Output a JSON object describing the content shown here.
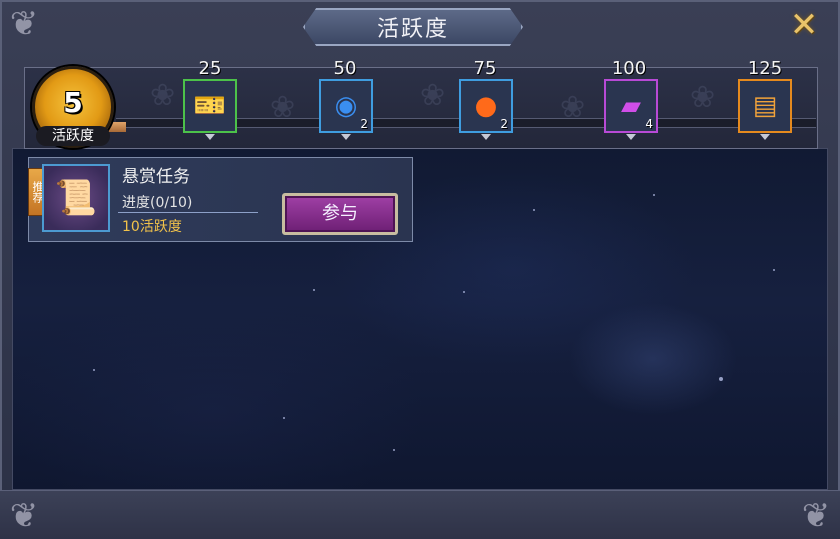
{
  "window": {
    "title": "活跃度",
    "close_icon": "close-x-icon"
  },
  "activity": {
    "current": "5",
    "label": "活跃度",
    "progress_fraction": 0.04
  },
  "milestones": [
    {
      "threshold": "25",
      "icon": "ticket-icon",
      "count": "",
      "border": "#4cc24a"
    },
    {
      "threshold": "50",
      "icon": "blue-orb-scroll-icon",
      "count": "2",
      "border": "#3f9de0"
    },
    {
      "threshold": "75",
      "icon": "fire-orb-icon",
      "count": "2",
      "border": "#3f9de0"
    },
    {
      "threshold": "100",
      "icon": "purple-card-icon",
      "count": "4",
      "border": "#b84ad6"
    },
    {
      "threshold": "125",
      "icon": "gold-scroll-icon",
      "count": "",
      "border": "#e58a1e"
    }
  ],
  "quest": {
    "tag": "推荐",
    "name": "悬赏任务",
    "progress": "进度(0/10)",
    "reward": "10活跃度",
    "join_label": "参与",
    "icon": "scroll-bundle-icon"
  },
  "colors": {
    "accent_gold": "#f2c24a",
    "button_purple": "#8a2f91"
  }
}
